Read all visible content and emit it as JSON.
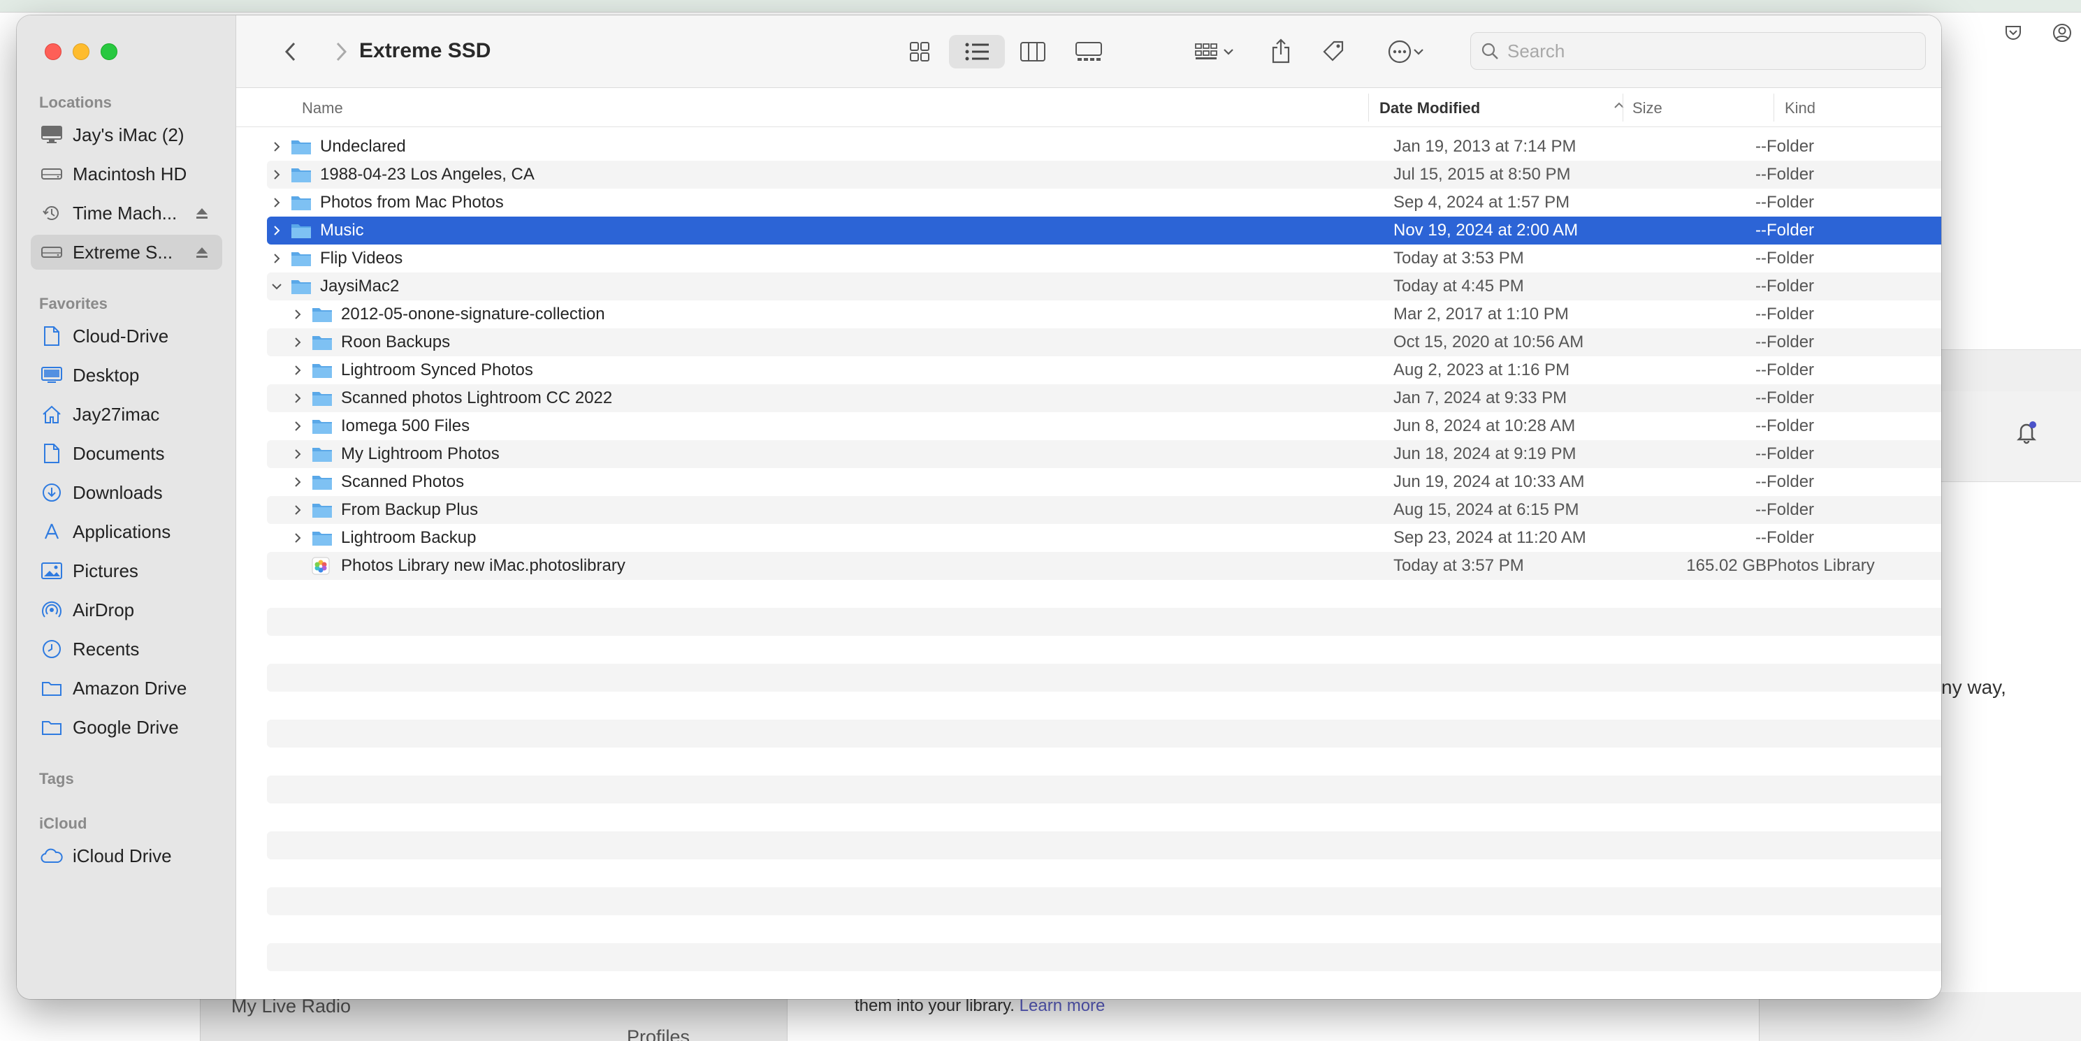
{
  "background_app": {
    "tail_text": "ny way,",
    "left_row_1": "My Live Radio",
    "left_row_2": "Profiles",
    "card_text": "them into your library.",
    "card_link": "Learn more"
  },
  "window": {
    "title": "Extreme SSD"
  },
  "sidebar": {
    "locations_heading": "Locations",
    "locations": [
      {
        "label": "Jay's iMac (2)",
        "icon": "imac-icon"
      },
      {
        "label": "Macintosh HD",
        "icon": "disk-icon"
      },
      {
        "label": "Time Mach...",
        "icon": "time-machine-icon"
      },
      {
        "label": "Extreme S...",
        "icon": "disk-icon"
      }
    ],
    "favorites_heading": "Favorites",
    "favorites": [
      {
        "label": "Cloud-Drive",
        "icon": "document-icon"
      },
      {
        "label": "Desktop",
        "icon": "desktop-icon"
      },
      {
        "label": "Jay27imac",
        "icon": "home-icon"
      },
      {
        "label": "Documents",
        "icon": "document-icon"
      },
      {
        "label": "Downloads",
        "icon": "download-icon"
      },
      {
        "label": "Applications",
        "icon": "applications-icon"
      },
      {
        "label": "Pictures",
        "icon": "pictures-icon"
      },
      {
        "label": "AirDrop",
        "icon": "airdrop-icon"
      },
      {
        "label": "Recents",
        "icon": "clock-icon"
      },
      {
        "label": "Amazon Drive",
        "icon": "folder-icon"
      },
      {
        "label": "Google Drive",
        "icon": "folder-icon"
      }
    ],
    "tags_heading": "Tags",
    "icloud_heading": "iCloud",
    "icloud": [
      {
        "label": "iCloud Drive",
        "icon": "cloud-icon"
      }
    ]
  },
  "toolbar": {
    "search_placeholder": "Search"
  },
  "columns": {
    "name": "Name",
    "date": "Date Modified",
    "size": "Size",
    "kind": "Kind"
  },
  "files": [
    {
      "name": "Undeclared",
      "date": "Jan 19, 2013 at 7:14 PM",
      "size": "--",
      "kind": "Folder"
    },
    {
      "name": "1988-04-23 Los Angeles, CA",
      "date": "Jul 15, 2015 at 8:50 PM",
      "size": "--",
      "kind": "Folder"
    },
    {
      "name": "Photos from Mac Photos",
      "date": "Sep 4, 2024 at 1:57 PM",
      "size": "--",
      "kind": "Folder"
    },
    {
      "name": "Music",
      "date": "Nov 19, 2024 at 2:00 AM",
      "size": "--",
      "kind": "Folder"
    },
    {
      "name": "Flip Videos",
      "date": "Today at 3:53 PM",
      "size": "--",
      "kind": "Folder"
    },
    {
      "name": "JaysiMac2",
      "date": "Today at 4:45 PM",
      "size": "--",
      "kind": "Folder"
    },
    {
      "name": "2012-05-onone-signature-collection",
      "date": "Mar 2, 2017 at 1:10 PM",
      "size": "--",
      "kind": "Folder"
    },
    {
      "name": "Roon Backups",
      "date": "Oct 15, 2020 at 10:56 AM",
      "size": "--",
      "kind": "Folder"
    },
    {
      "name": "Lightroom Synced Photos",
      "date": "Aug 2, 2023 at 1:16 PM",
      "size": "--",
      "kind": "Folder"
    },
    {
      "name": "Scanned photos Lightroom CC 2022",
      "date": "Jan 7, 2024 at 9:33 PM",
      "size": "--",
      "kind": "Folder"
    },
    {
      "name": "Iomega 500 Files",
      "date": "Jun 8, 2024 at 10:28 AM",
      "size": "--",
      "kind": "Folder"
    },
    {
      "name": "My Lightroom Photos",
      "date": "Jun 18, 2024 at 9:19 PM",
      "size": "--",
      "kind": "Folder"
    },
    {
      "name": "Scanned Photos",
      "date": "Jun 19, 2024 at 10:33 AM",
      "size": "--",
      "kind": "Folder"
    },
    {
      "name": "From Backup Plus",
      "date": "Aug 15, 2024 at 6:15 PM",
      "size": "--",
      "kind": "Folder"
    },
    {
      "name": "Lightroom Backup",
      "date": "Sep 23, 2024 at 11:20 AM",
      "size": "--",
      "kind": "Folder"
    },
    {
      "name": "Photos Library new iMac.photoslibrary",
      "date": "Today at 3:57 PM",
      "size": "165.02 GB",
      "kind": "Photos Library"
    }
  ],
  "colors": {
    "selection": "#2c64d6",
    "folder": "#6ab2ec",
    "traffic_red": "#fe5f57",
    "traffic_yellow": "#febc2e",
    "traffic_green": "#28c840"
  }
}
